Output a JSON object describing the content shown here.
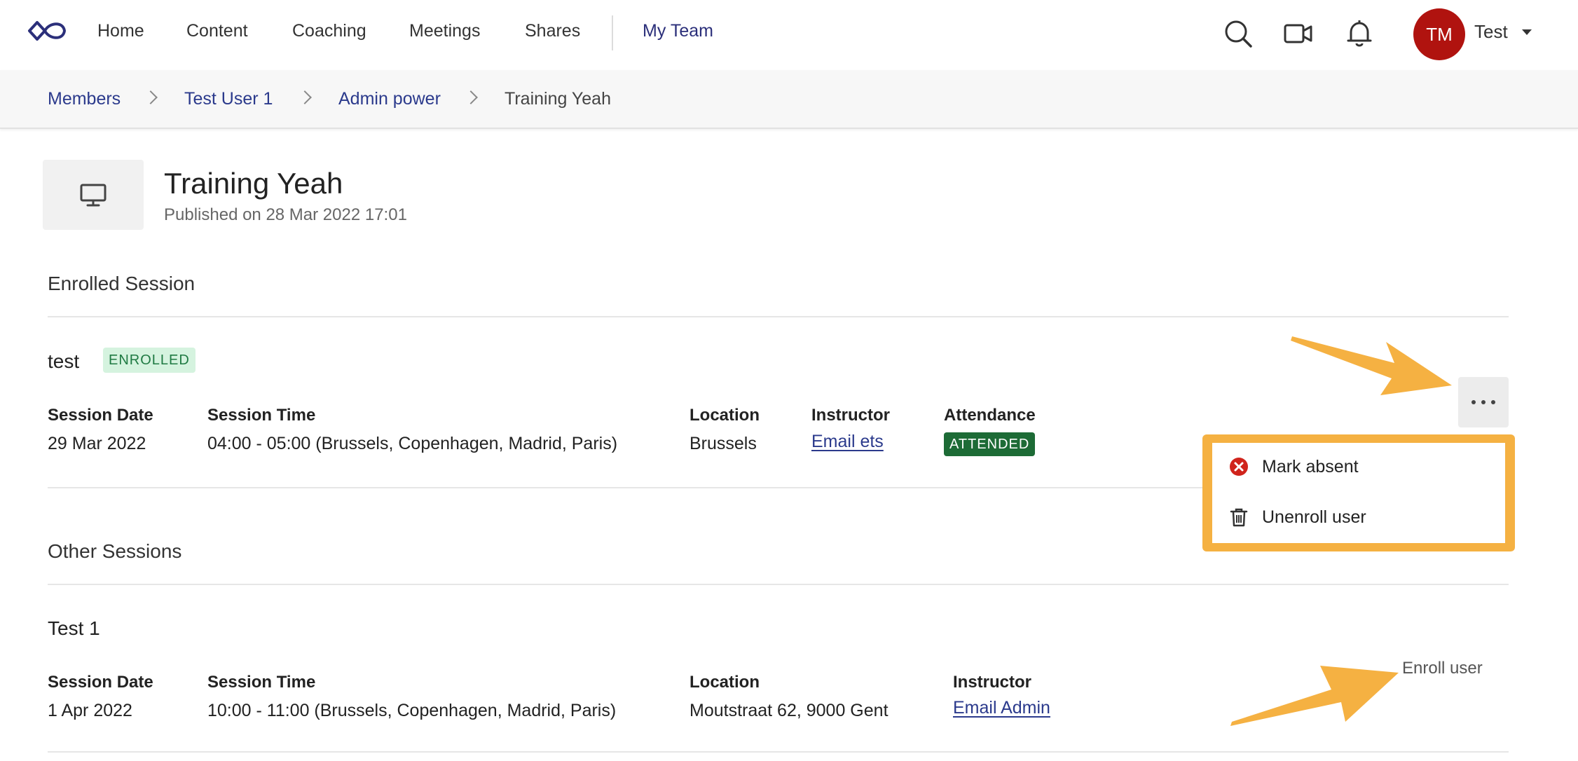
{
  "nav": {
    "items": [
      {
        "label": "Home"
      },
      {
        "label": "Content"
      },
      {
        "label": "Coaching"
      },
      {
        "label": "Meetings"
      },
      {
        "label": "Shares"
      }
    ],
    "active_item": "My Team",
    "user": {
      "initials": "TM",
      "name": "Test"
    },
    "icons": [
      "logo-icon",
      "search-icon",
      "video-camera-icon",
      "bell-icon",
      "caret-down-icon"
    ]
  },
  "breadcrumb": {
    "items": [
      "Members",
      "Test User 1",
      "Admin power"
    ],
    "current": "Training Yeah"
  },
  "header": {
    "icon": "monitor-icon",
    "title": "Training Yeah",
    "published": "Published on 28 Mar 2022 17:01"
  },
  "enrolled": {
    "section_title": "Enrolled Session",
    "session": {
      "name": "test",
      "status_badge": "ENROLLED",
      "date_label": "Session Date",
      "date": "29 Mar 2022",
      "time_label": "Session Time",
      "time": "04:00 - 05:00 (Brussels, Copenhagen, Madrid, Paris)",
      "location_label": "Location",
      "location": "Brussels",
      "instructor_label": "Instructor",
      "instructor": "Email ets",
      "attendance_label": "Attendance",
      "attendance": "ATTENDED"
    },
    "menu": {
      "items": [
        {
          "label": "Mark absent",
          "icon": "error-circle-icon"
        },
        {
          "label": "Unenroll user",
          "icon": "trash-icon"
        }
      ]
    }
  },
  "other": {
    "section_title": "Other Sessions",
    "session": {
      "name": "Test 1",
      "date_label": "Session Date",
      "date": "1 Apr 2022",
      "time_label": "Session Time",
      "time": "10:00 - 11:00 (Brussels, Copenhagen, Madrid, Paris)",
      "location_label": "Location",
      "location": "Moutstraat 62, 9000 Gent",
      "instructor_label": "Instructor",
      "instructor": "Email Admin",
      "action": "Enroll user"
    }
  },
  "colors": {
    "brand": "#2b2f7a",
    "avatar": "#b0130f",
    "highlight": "#f5b142",
    "enrolled_bg": "#d5f3df",
    "attended_bg": "#1d6b36"
  }
}
